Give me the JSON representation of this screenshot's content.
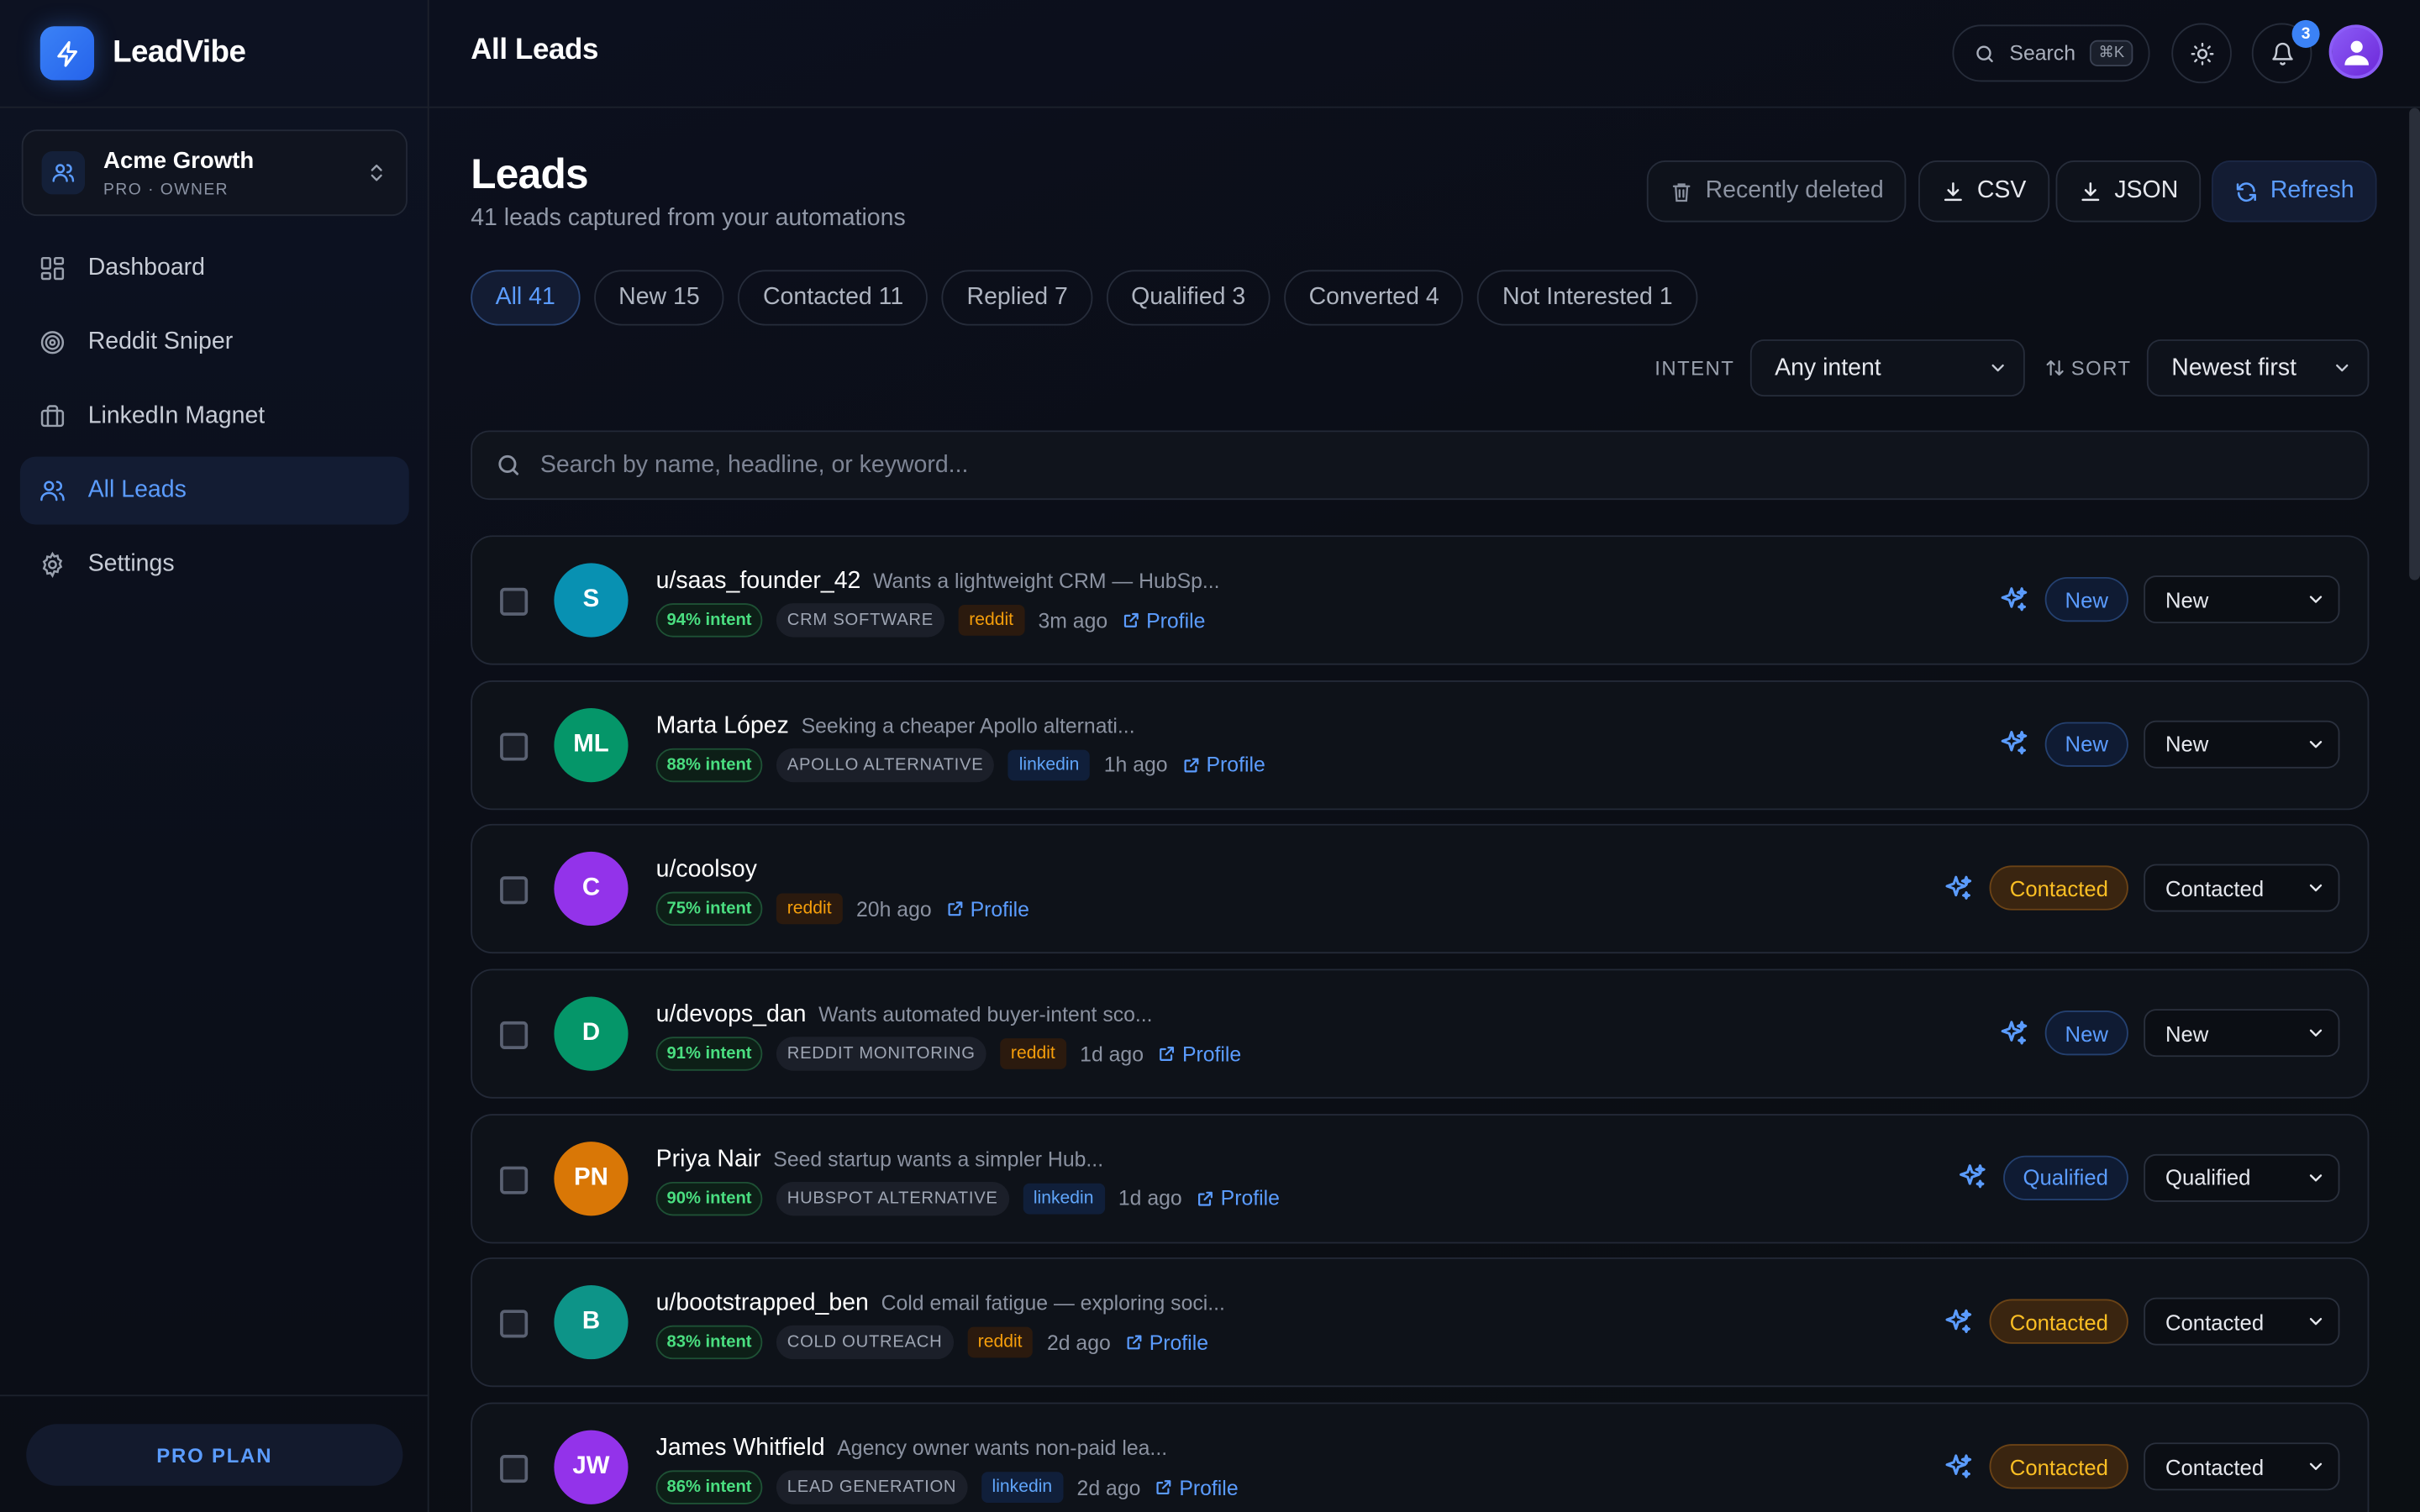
{
  "brand": {
    "name": "LeadVibe"
  },
  "workspace": {
    "name": "Acme Growth",
    "subtitle": "PRO · OWNER"
  },
  "nav": [
    {
      "label": "Dashboard",
      "icon": "grid-icon"
    },
    {
      "label": "Reddit Sniper",
      "icon": "target-icon"
    },
    {
      "label": "LinkedIn Magnet",
      "icon": "briefcase-icon"
    },
    {
      "label": "All Leads",
      "icon": "users-icon",
      "active": true
    },
    {
      "label": "Settings",
      "icon": "gear-icon"
    }
  ],
  "plan": {
    "label": "PRO PLAN"
  },
  "topbar": {
    "title": "All Leads",
    "search_label": "Search",
    "search_shortcut": "⌘K",
    "notifications": "3"
  },
  "page": {
    "title": "Leads",
    "subtitle": "41 leads captured from your automations"
  },
  "actions": {
    "recently_deleted": "Recently deleted",
    "csv": "CSV",
    "json": "JSON",
    "refresh": "Refresh"
  },
  "tabs": [
    {
      "label": "All 41",
      "active": true
    },
    {
      "label": "New 15"
    },
    {
      "label": "Contacted 11"
    },
    {
      "label": "Replied 7"
    },
    {
      "label": "Qualified 3"
    },
    {
      "label": "Converted 4"
    },
    {
      "label": "Not Interested 1"
    }
  ],
  "filters": {
    "intent_label": "INTENT",
    "intent_value": "Any intent",
    "sort_label": "SORT",
    "sort_value": "Newest first"
  },
  "search": {
    "placeholder": "Search by name, headline, or keyword..."
  },
  "leads": [
    {
      "initials": "S",
      "color": "#0891b2",
      "name": "u/saas_founder_42",
      "headline": "Wants a lightweight CRM — HubSp...",
      "intent": "94% intent",
      "keyword": "CRM SOFTWARE",
      "source": "reddit",
      "time": "3m ago",
      "profile": "Profile",
      "status": "New",
      "select": "New"
    },
    {
      "initials": "ML",
      "color": "#059669",
      "name": "Marta López",
      "headline": "Seeking a cheaper Apollo alternati...",
      "intent": "88% intent",
      "keyword": "APOLLO ALTERNATIVE",
      "source": "linkedin",
      "time": "1h ago",
      "profile": "Profile",
      "status": "New",
      "select": "New"
    },
    {
      "initials": "C",
      "color": "#9333ea",
      "name": "u/coolsoy",
      "headline": "",
      "intent": "75% intent",
      "keyword": "",
      "source": "reddit",
      "time": "20h ago",
      "profile": "Profile",
      "status": "Contacted",
      "select": "Contacted"
    },
    {
      "initials": "D",
      "color": "#059669",
      "name": "u/devops_dan",
      "headline": "Wants automated buyer-intent sco...",
      "intent": "91% intent",
      "keyword": "REDDIT MONITORING",
      "source": "reddit",
      "time": "1d ago",
      "profile": "Profile",
      "status": "New",
      "select": "New"
    },
    {
      "initials": "PN",
      "color": "#d97706",
      "name": "Priya Nair",
      "headline": "Seed startup wants a simpler Hub...",
      "intent": "90% intent",
      "keyword": "HUBSPOT ALTERNATIVE",
      "source": "linkedin",
      "time": "1d ago",
      "profile": "Profile",
      "status": "Qualified",
      "select": "Qualified"
    },
    {
      "initials": "B",
      "color": "#0d9488",
      "name": "u/bootstrapped_ben",
      "headline": "Cold email fatigue — exploring soci...",
      "intent": "83% intent",
      "keyword": "COLD OUTREACH",
      "source": "reddit",
      "time": "2d ago",
      "profile": "Profile",
      "status": "Contacted",
      "select": "Contacted"
    },
    {
      "initials": "JW",
      "color": "#9333ea",
      "name": "James Whitfield",
      "headline": "Agency owner wants non-paid lea...",
      "intent": "86% intent",
      "keyword": "LEAD GENERATION",
      "source": "linkedin",
      "time": "2d ago",
      "profile": "Profile",
      "status": "Contacted",
      "select": "Contacted"
    }
  ]
}
